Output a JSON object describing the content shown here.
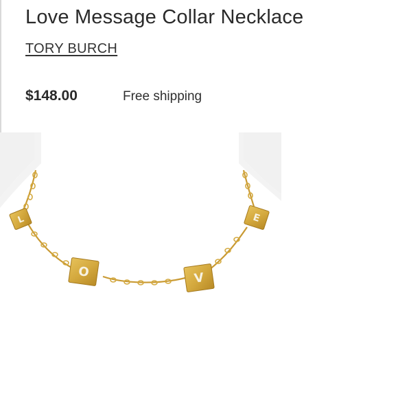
{
  "product": {
    "title": "Love Message Collar Necklace",
    "brand": "TORY BURCH",
    "price": "$148.00",
    "shipping": "Free shipping"
  },
  "image": {
    "pendant_letters": [
      "L",
      "O",
      "V",
      "E"
    ],
    "colors": {
      "background": "#f1f1f1",
      "bust": "#ffffff",
      "gold": "#d4a93e",
      "gold_dark": "#b88a26"
    }
  }
}
